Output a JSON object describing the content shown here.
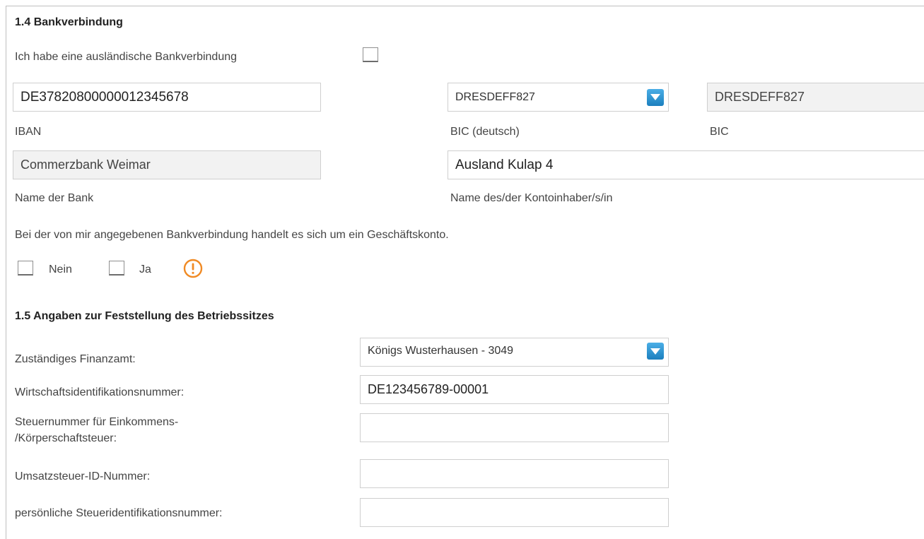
{
  "section_bank": {
    "heading": "1.4 Bankverbindung",
    "foreign_label": "Ich habe eine ausländische Bankverbindung",
    "iban_value": "DE37820800000012345678",
    "iban_label": "IBAN",
    "bic_de_value": "DRESDEFF827",
    "bic_de_label": "BIC (deutsch)",
    "bic_value": "DRESDEFF827",
    "bic_label": "BIC",
    "bank_name_value": "Commerzbank Weimar",
    "bank_name_label": "Name der Bank",
    "holder_value": "Ausland Kulap 4",
    "holder_label": "Name des/der Kontoinhaber/s/in",
    "business_question": "Bei der von mir angegebenen Bankverbindung handelt es sich um ein Geschäftskonto.",
    "no_label": "Nein",
    "yes_label": "Ja"
  },
  "section_seat": {
    "heading": "1.5 Angaben zur Feststellung des Betriebssitzes",
    "tax_office_label": "Zuständiges Finanzamt:",
    "tax_office_value": "Königs Wusterhausen - 3049",
    "wid_label": "Wirtschaftsidentifikationsnummer:",
    "wid_value": "DE123456789-00001",
    "tax_no_label_1": "Steuernummer für Einkommens-",
    "tax_no_label_2": "/Körperschaftsteuer:",
    "tax_no_value": "",
    "vat_label": "Umsatzsteuer-ID-Nummer:",
    "vat_value": "",
    "personal_tax_label": "persönliche Steueridentifikationsnummer:",
    "personal_tax_value": ""
  },
  "colors": {
    "warning": "#f08a24",
    "dropdown_button": "#1c7fbe"
  },
  "icons": {
    "dropdown": "chevron-down-icon",
    "warning": "exclamation-circle-icon"
  }
}
